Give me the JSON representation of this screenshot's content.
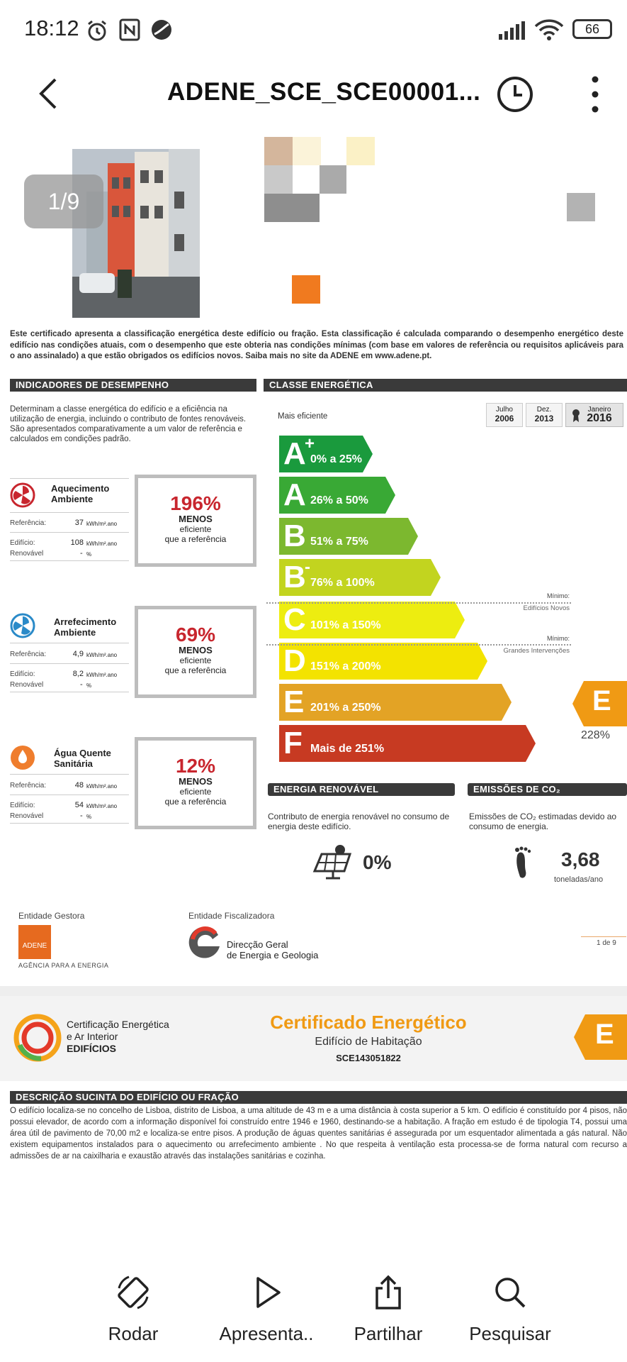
{
  "status_bar": {
    "time": "18:12",
    "battery": "66"
  },
  "app_bar": {
    "title": "ADENE_SCE_SCE00001..."
  },
  "page_badge": "1/9",
  "intro_text": "Este certificado apresenta a classificação energética deste edifício ou fração. Esta classificação é calculada comparando o desempenho energético deste edifício nas condições atuais, com o desempenho que este obteria nas condições mínimas (com base em valores de referência ou requisitos aplicáveis para o ano assinalado) a que estão obrigados os edifícios novos. Saiba mais no site da ADENE em www.adene.pt.",
  "indicators": {
    "header": "INDICADORES DE DESEMPENHO",
    "description": "Determinam a classe energética do edifício e a eficiência na utilização de energia, incluindo o contributo de fontes renováveis. São apresentados comparativamente a um valor de referência e calculados em condições padrão.",
    "items": [
      {
        "name": "Aquecimento Ambiente",
        "ref_label": "Referência:",
        "ref_value": "37",
        "unit": "kWh/m².ano",
        "bld_label": "Edifício:",
        "bld_value": "108",
        "ren_label": "Renovável",
        "ren_value": "-",
        "ren_unit": "%",
        "pct": "196%",
        "l1": "MENOS",
        "l2": "eficiente",
        "l3": "que a referência"
      },
      {
        "name": "Arrefecimento Ambiente",
        "ref_label": "Referência:",
        "ref_value": "4,9",
        "unit": "kWh/m².ano",
        "bld_label": "Edifício:",
        "bld_value": "8,2",
        "ren_label": "Renovável",
        "ren_value": "-",
        "ren_unit": "%",
        "pct": "69%",
        "l1": "MENOS",
        "l2": "eficiente",
        "l3": "que a referência"
      },
      {
        "name": "Água Quente Sanitária",
        "ref_label": "Referência:",
        "ref_value": "48",
        "unit": "kWh/m².ano",
        "bld_label": "Edifício:",
        "bld_value": "54",
        "ren_label": "Renovável",
        "ren_value": "-",
        "ren_unit": "%",
        "pct": "12%",
        "l1": "MENOS",
        "l2": "eficiente",
        "l3": "que a referência"
      }
    ]
  },
  "energy_class": {
    "header": "CLASSE ENERGÉTICA",
    "mais_eficiente": "Mais eficiente",
    "tabs": [
      {
        "month": "Julho",
        "year": "2006"
      },
      {
        "month": "Dez.",
        "year": "2013"
      },
      {
        "month": "Janeiro",
        "year": "2016"
      }
    ],
    "classes": [
      {
        "letter": "A",
        "sup": "+",
        "range": "0% a 25%",
        "color": "#1a9a3d"
      },
      {
        "letter": "A",
        "sup": "",
        "range": "26% a 50%",
        "color": "#39a935"
      },
      {
        "letter": "B",
        "sup": "",
        "range": "51% a 75%",
        "color": "#7cb82f"
      },
      {
        "letter": "B",
        "sup": "-",
        "range": "76% a 100%",
        "color": "#c2d41f"
      },
      {
        "letter": "C",
        "sup": "",
        "range": "101% a 150%",
        "color": "#eded10"
      },
      {
        "letter": "D",
        "sup": "",
        "range": "151% a 200%",
        "color": "#f3e300"
      },
      {
        "letter": "E",
        "sup": "",
        "range": "201% a 250%",
        "color": "#e3a325"
      },
      {
        "letter": "F",
        "sup": "",
        "range": "Mais de 251%",
        "color": "#c73a22"
      }
    ],
    "min_new_l1": "Mínimo:",
    "min_new_l2": "Edifícios Novos",
    "min_int_l1": "Mínimo:",
    "min_int_l2": "Grandes Intervenções",
    "result_letter": "E",
    "result_pct": "228%",
    "result_color": "#f09a14"
  },
  "renewable": {
    "header": "ENERGIA RENOVÁVEL",
    "text": "Contributo de energia renovável no consumo de energia deste edifício.",
    "value": "0%"
  },
  "emissions": {
    "header": "EMISSÕES DE CO₂",
    "text": "Emissões de CO₂ estimadas devido ao consumo de energia.",
    "value": "3,68",
    "unit": "toneladas/ano"
  },
  "entities": {
    "gestora_label": "Entidade Gestora",
    "gestora_logo": "ADENE",
    "gestora_sub": "AGÊNCIA PARA A ENERGIA",
    "fisc_label": "Entidade Fiscalizadora",
    "fisc_name1": "Direcção Geral",
    "fisc_name2": "de Energia e Geologia",
    "page_number": "1 de 9"
  },
  "page2": {
    "logo_l1": "Certificação Energética",
    "logo_l2": "e Ar Interior",
    "logo_l3": "EDIFÍCIOS",
    "title": "Certificado Energético",
    "subtitle": "Edifício de Habitação",
    "code": "SCE143051822",
    "class_letter": "E",
    "desc_header": "DESCRIÇÃO SUCINTA DO EDIFÍCIO OU FRAÇÃO",
    "desc_text": "O edifício localiza-se no concelho de Lisboa, distrito de Lisboa, a uma altitude de 43 m e a uma distância à costa superior a 5 km. O edifício é constituído por 4 pisos, não possui elevador, de acordo com a informação disponível foi construído entre 1946 e 1960, destinando-se a habitação. A fração em estudo é de tipologia T4, possui uma área útil de pavimento de 70,00 m2 e localiza-se entre pisos. A produção de águas quentes sanitárias é assegurada por um esquentador alimentada a gás natural. Não existem equipamentos instalados para o aquecimento ou arrefecimento ambiente . No que respeita à ventilação esta processa-se de forma natural com recurso a admissões de ar na caixilharia e exaustão através das instalações sanitárias e cozinha."
  },
  "bottom_nav": [
    {
      "label": "Rodar",
      "icon": "rotate-icon"
    },
    {
      "label": "Apresenta..",
      "icon": "play-icon"
    },
    {
      "label": "Partilhar",
      "icon": "share-icon"
    },
    {
      "label": "Pesquisar",
      "icon": "search-icon"
    }
  ]
}
